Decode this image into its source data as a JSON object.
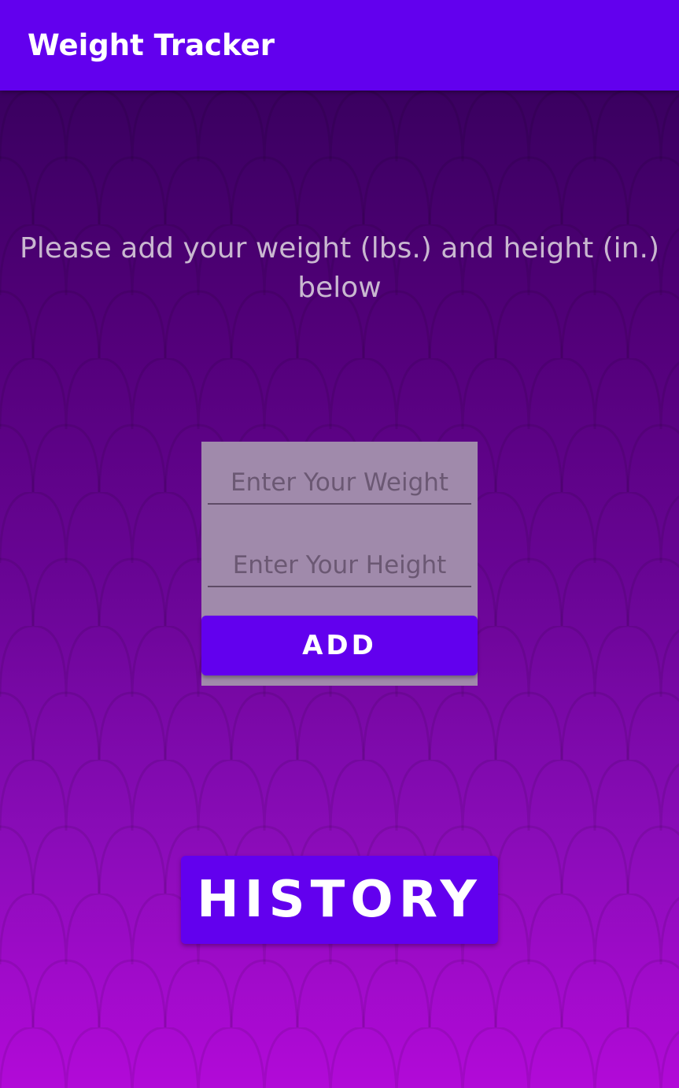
{
  "app_bar": {
    "title": "Weight Tracker",
    "color": "#6200EE"
  },
  "main": {
    "instructions": "Please add your weight (lbs.) and height (in.) below",
    "weight_field": {
      "value": "",
      "placeholder": "Enter Your Weight"
    },
    "height_field": {
      "value": "",
      "placeholder": "Enter Your Height"
    },
    "add_label": "ADD",
    "history_label": "HISTORY"
  },
  "colors": {
    "accent": "#6200EE",
    "background_top": "#3a0060",
    "background_bottom": "#b20ad8",
    "card": "#a08aab"
  }
}
